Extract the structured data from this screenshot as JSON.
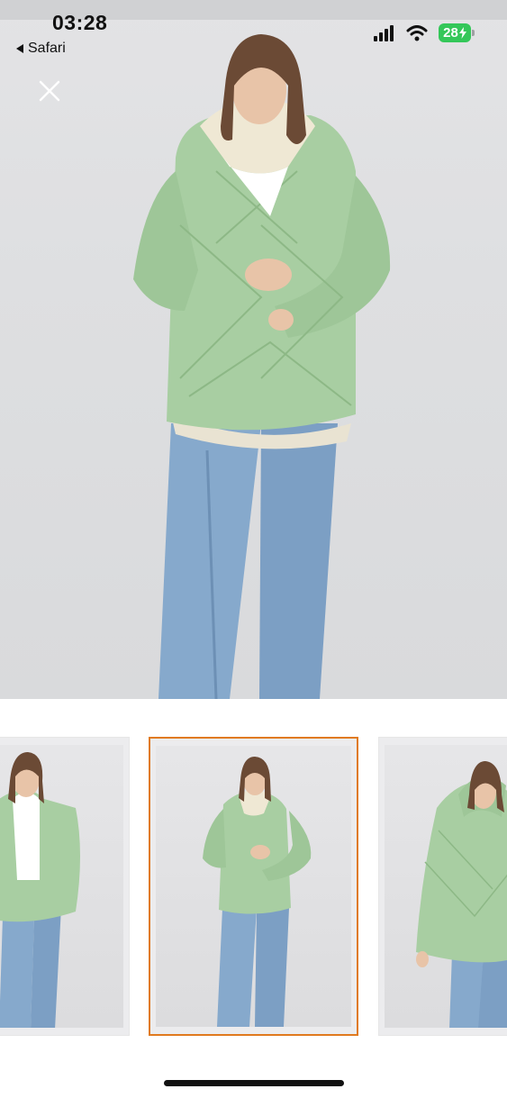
{
  "status_bar": {
    "time": "03:28",
    "back_app": "Safari",
    "battery": "28",
    "icons": [
      "signal-icon",
      "wifi-icon",
      "charging-bolt-icon"
    ]
  },
  "viewer": {
    "close_icon": "close-icon",
    "image_description_none": ""
  },
  "thumbnails": {
    "count": 3,
    "active_index": 1
  },
  "colors": {
    "accent_border": "#e07a1e",
    "jacket": "#a9cfa4",
    "jeans": "#7fa4c9",
    "battery": "#34c759"
  }
}
